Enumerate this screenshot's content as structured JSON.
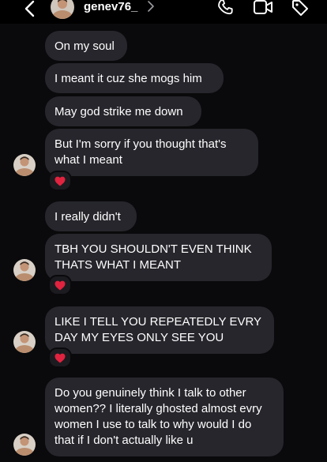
{
  "header": {
    "username": "genev76_"
  },
  "icons": {
    "back": "chevron-left-icon",
    "profile_link": "chevron-right-icon",
    "call": "phone-icon",
    "video": "video-camera-icon",
    "tag": "tag-icon",
    "reaction": "red-heart-icon"
  },
  "colors": {
    "background": "#0a0a0c",
    "bubble": "#26262c",
    "heart": "#e0233f"
  },
  "messages": [
    {
      "text": "On my soul"
    },
    {
      "text": "I meant it cuz she mogs him"
    },
    {
      "text": "May god strike me down"
    },
    {
      "text": "But I'm sorry if you thought that's what I meant",
      "reaction": "❤️"
    },
    {
      "text": "I really didn't"
    },
    {
      "text": "TBH YOU SHOULDN'T EVEN THINK THATS WHAT I MEANT",
      "reaction": "❤️"
    },
    {
      "text": "LIKE I TELL YOU REPEATEDLY EVRY DAY MY EYES ONLY SEE YOU",
      "reaction": "❤️"
    },
    {
      "text": "Do you genuinely think I talk to other women?? I literally ghosted almost evry women I use to talk to why would I do that if I don't actually like u"
    }
  ]
}
